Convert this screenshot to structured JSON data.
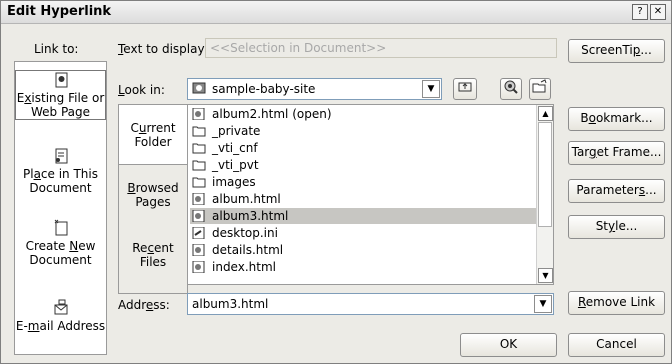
{
  "title": "Edit Hyperlink",
  "title_buttons": {
    "help": "?",
    "close": "✕"
  },
  "link_to_label": "Link to:",
  "link_to_items": [
    {
      "label_pre": "E",
      "label_ul": "x",
      "label_post": "isting File or",
      "label_line2": "Web Page",
      "selected": true,
      "icon": "web-page-icon"
    },
    {
      "label_pre": "Pl",
      "label_ul": "a",
      "label_post": "ce in This",
      "label_line2": "Document",
      "selected": false,
      "icon": "document-place-icon"
    },
    {
      "label_pre": "Create ",
      "label_ul": "N",
      "label_post": "ew",
      "label_line2": "Document",
      "selected": false,
      "icon": "new-document-icon"
    },
    {
      "label_pre": "E-",
      "label_ul": "m",
      "label_post": "ail Address",
      "label_line2": "",
      "selected": false,
      "icon": "email-icon"
    }
  ],
  "text_to_display": {
    "label_ul": "T",
    "label_post": "ext to display:",
    "value": "<<Selection in Document>>"
  },
  "look_in": {
    "label_ul": "L",
    "label_post": "ook in:",
    "value": "sample-baby-site"
  },
  "subnav": [
    {
      "line1_pre": "C",
      "line1_ul": "u",
      "line1_post": "rrent",
      "line2": "Folder",
      "selected": true
    },
    {
      "line1_pre": "",
      "line1_ul": "B",
      "line1_post": "rowsed",
      "line2": "Pages",
      "selected": false
    },
    {
      "line1_pre": "Re",
      "line1_ul": "c",
      "line1_post": "ent",
      "line2": "Files",
      "selected": false
    }
  ],
  "files": [
    {
      "name": "album2.html (open)",
      "type": "html",
      "selected": false
    },
    {
      "name": "_private",
      "type": "folder",
      "selected": false
    },
    {
      "name": "_vti_cnf",
      "type": "folder",
      "selected": false
    },
    {
      "name": "_vti_pvt",
      "type": "folder",
      "selected": false
    },
    {
      "name": "images",
      "type": "folder",
      "selected": false
    },
    {
      "name": "album.html",
      "type": "html",
      "selected": false
    },
    {
      "name": "album3.html",
      "type": "html",
      "selected": true
    },
    {
      "name": "desktop.ini",
      "type": "ini",
      "selected": false
    },
    {
      "name": "details.html",
      "type": "html",
      "selected": false
    },
    {
      "name": "index.html",
      "type": "html",
      "selected": false
    }
  ],
  "address": {
    "label_pre": "Addr",
    "label_ul": "e",
    "label_post": "ss:",
    "value": "album3.html"
  },
  "right_buttons": {
    "screentip": {
      "pre": "ScreenTi",
      "ul": "p",
      "post": "..."
    },
    "bookmark": {
      "pre": "B",
      "ul": "o",
      "post": "okmark..."
    },
    "target_frame": {
      "pre": "Tar",
      "ul": "g",
      "post": "et Frame..."
    },
    "parameters": {
      "pre": "Parameter",
      "ul": "s",
      "post": "..."
    },
    "style": {
      "pre": "St",
      "ul": "y",
      "post": "le..."
    },
    "remove_link": {
      "pre": "",
      "ul": "R",
      "post": "emove Link"
    }
  },
  "ok_label": "OK",
  "cancel_label": "Cancel"
}
